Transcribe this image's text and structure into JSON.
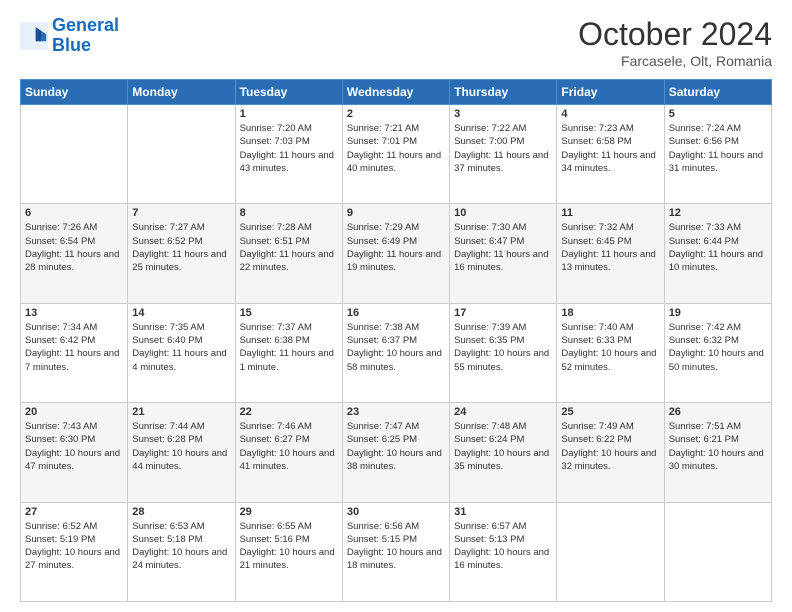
{
  "header": {
    "logo_general": "General",
    "logo_blue": "Blue",
    "month_title": "October 2024",
    "subtitle": "Farcasele, Olt, Romania"
  },
  "weekdays": [
    "Sunday",
    "Monday",
    "Tuesday",
    "Wednesday",
    "Thursday",
    "Friday",
    "Saturday"
  ],
  "weeks": [
    [
      {
        "day": "",
        "sunrise": "",
        "sunset": "",
        "daylight": ""
      },
      {
        "day": "",
        "sunrise": "",
        "sunset": "",
        "daylight": ""
      },
      {
        "day": "1",
        "sunrise": "Sunrise: 7:20 AM",
        "sunset": "Sunset: 7:03 PM",
        "daylight": "Daylight: 11 hours and 43 minutes."
      },
      {
        "day": "2",
        "sunrise": "Sunrise: 7:21 AM",
        "sunset": "Sunset: 7:01 PM",
        "daylight": "Daylight: 11 hours and 40 minutes."
      },
      {
        "day": "3",
        "sunrise": "Sunrise: 7:22 AM",
        "sunset": "Sunset: 7:00 PM",
        "daylight": "Daylight: 11 hours and 37 minutes."
      },
      {
        "day": "4",
        "sunrise": "Sunrise: 7:23 AM",
        "sunset": "Sunset: 6:58 PM",
        "daylight": "Daylight: 11 hours and 34 minutes."
      },
      {
        "day": "5",
        "sunrise": "Sunrise: 7:24 AM",
        "sunset": "Sunset: 6:56 PM",
        "daylight": "Daylight: 11 hours and 31 minutes."
      }
    ],
    [
      {
        "day": "6",
        "sunrise": "Sunrise: 7:26 AM",
        "sunset": "Sunset: 6:54 PM",
        "daylight": "Daylight: 11 hours and 28 minutes."
      },
      {
        "day": "7",
        "sunrise": "Sunrise: 7:27 AM",
        "sunset": "Sunset: 6:52 PM",
        "daylight": "Daylight: 11 hours and 25 minutes."
      },
      {
        "day": "8",
        "sunrise": "Sunrise: 7:28 AM",
        "sunset": "Sunset: 6:51 PM",
        "daylight": "Daylight: 11 hours and 22 minutes."
      },
      {
        "day": "9",
        "sunrise": "Sunrise: 7:29 AM",
        "sunset": "Sunset: 6:49 PM",
        "daylight": "Daylight: 11 hours and 19 minutes."
      },
      {
        "day": "10",
        "sunrise": "Sunrise: 7:30 AM",
        "sunset": "Sunset: 6:47 PM",
        "daylight": "Daylight: 11 hours and 16 minutes."
      },
      {
        "day": "11",
        "sunrise": "Sunrise: 7:32 AM",
        "sunset": "Sunset: 6:45 PM",
        "daylight": "Daylight: 11 hours and 13 minutes."
      },
      {
        "day": "12",
        "sunrise": "Sunrise: 7:33 AM",
        "sunset": "Sunset: 6:44 PM",
        "daylight": "Daylight: 11 hours and 10 minutes."
      }
    ],
    [
      {
        "day": "13",
        "sunrise": "Sunrise: 7:34 AM",
        "sunset": "Sunset: 6:42 PM",
        "daylight": "Daylight: 11 hours and 7 minutes."
      },
      {
        "day": "14",
        "sunrise": "Sunrise: 7:35 AM",
        "sunset": "Sunset: 6:40 PM",
        "daylight": "Daylight: 11 hours and 4 minutes."
      },
      {
        "day": "15",
        "sunrise": "Sunrise: 7:37 AM",
        "sunset": "Sunset: 6:38 PM",
        "daylight": "Daylight: 11 hours and 1 minute."
      },
      {
        "day": "16",
        "sunrise": "Sunrise: 7:38 AM",
        "sunset": "Sunset: 6:37 PM",
        "daylight": "Daylight: 10 hours and 58 minutes."
      },
      {
        "day": "17",
        "sunrise": "Sunrise: 7:39 AM",
        "sunset": "Sunset: 6:35 PM",
        "daylight": "Daylight: 10 hours and 55 minutes."
      },
      {
        "day": "18",
        "sunrise": "Sunrise: 7:40 AM",
        "sunset": "Sunset: 6:33 PM",
        "daylight": "Daylight: 10 hours and 52 minutes."
      },
      {
        "day": "19",
        "sunrise": "Sunrise: 7:42 AM",
        "sunset": "Sunset: 6:32 PM",
        "daylight": "Daylight: 10 hours and 50 minutes."
      }
    ],
    [
      {
        "day": "20",
        "sunrise": "Sunrise: 7:43 AM",
        "sunset": "Sunset: 6:30 PM",
        "daylight": "Daylight: 10 hours and 47 minutes."
      },
      {
        "day": "21",
        "sunrise": "Sunrise: 7:44 AM",
        "sunset": "Sunset: 6:28 PM",
        "daylight": "Daylight: 10 hours and 44 minutes."
      },
      {
        "day": "22",
        "sunrise": "Sunrise: 7:46 AM",
        "sunset": "Sunset: 6:27 PM",
        "daylight": "Daylight: 10 hours and 41 minutes."
      },
      {
        "day": "23",
        "sunrise": "Sunrise: 7:47 AM",
        "sunset": "Sunset: 6:25 PM",
        "daylight": "Daylight: 10 hours and 38 minutes."
      },
      {
        "day": "24",
        "sunrise": "Sunrise: 7:48 AM",
        "sunset": "Sunset: 6:24 PM",
        "daylight": "Daylight: 10 hours and 35 minutes."
      },
      {
        "day": "25",
        "sunrise": "Sunrise: 7:49 AM",
        "sunset": "Sunset: 6:22 PM",
        "daylight": "Daylight: 10 hours and 32 minutes."
      },
      {
        "day": "26",
        "sunrise": "Sunrise: 7:51 AM",
        "sunset": "Sunset: 6:21 PM",
        "daylight": "Daylight: 10 hours and 30 minutes."
      }
    ],
    [
      {
        "day": "27",
        "sunrise": "Sunrise: 6:52 AM",
        "sunset": "Sunset: 5:19 PM",
        "daylight": "Daylight: 10 hours and 27 minutes."
      },
      {
        "day": "28",
        "sunrise": "Sunrise: 6:53 AM",
        "sunset": "Sunset: 5:18 PM",
        "daylight": "Daylight: 10 hours and 24 minutes."
      },
      {
        "day": "29",
        "sunrise": "Sunrise: 6:55 AM",
        "sunset": "Sunset: 5:16 PM",
        "daylight": "Daylight: 10 hours and 21 minutes."
      },
      {
        "day": "30",
        "sunrise": "Sunrise: 6:56 AM",
        "sunset": "Sunset: 5:15 PM",
        "daylight": "Daylight: 10 hours and 18 minutes."
      },
      {
        "day": "31",
        "sunrise": "Sunrise: 6:57 AM",
        "sunset": "Sunset: 5:13 PM",
        "daylight": "Daylight: 10 hours and 16 minutes."
      },
      {
        "day": "",
        "sunrise": "",
        "sunset": "",
        "daylight": ""
      },
      {
        "day": "",
        "sunrise": "",
        "sunset": "",
        "daylight": ""
      }
    ]
  ]
}
